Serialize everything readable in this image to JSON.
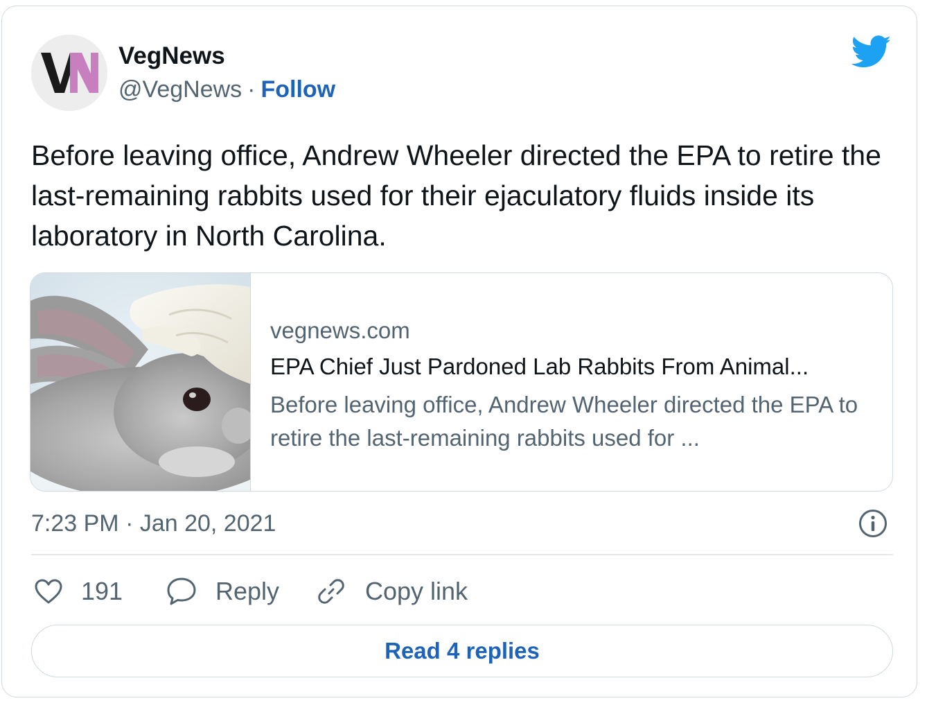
{
  "author": {
    "avatar_text": "VN",
    "name": "VegNews",
    "handle": "@VegNews",
    "separator": "·",
    "follow_label": "Follow"
  },
  "tweet": {
    "text": "Before leaving office, Andrew Wheeler directed the EPA to retire the last-remaining rabbits used for their ejaculatory fluids inside its laboratory in North Carolina.",
    "timestamp": "7:23 PM · Jan 20, 2021"
  },
  "link_card": {
    "domain": "vegnews.com",
    "title": "EPA Chief Just Pardoned Lab Rabbits From Animal...",
    "description": "Before leaving office, Andrew Wheeler directed the EPA to retire the last-remaining rabbits used for ..."
  },
  "actions": {
    "like_count": "191",
    "reply_label": "Reply",
    "copy_link_label": "Copy link"
  },
  "read_replies_label": "Read 4 replies",
  "colors": {
    "accent_link": "#1d63b8",
    "twitter_blue": "#1da1f2",
    "muted_text": "#536471",
    "border": "#cfd9de",
    "logo_v": "#1a1a1a",
    "logo_n": "#c77fc0"
  },
  "icons": {
    "platform": "twitter-bird-icon",
    "info": "info-icon",
    "like": "heart-icon",
    "reply": "speech-bubble-icon",
    "copy_link": "link-icon"
  }
}
